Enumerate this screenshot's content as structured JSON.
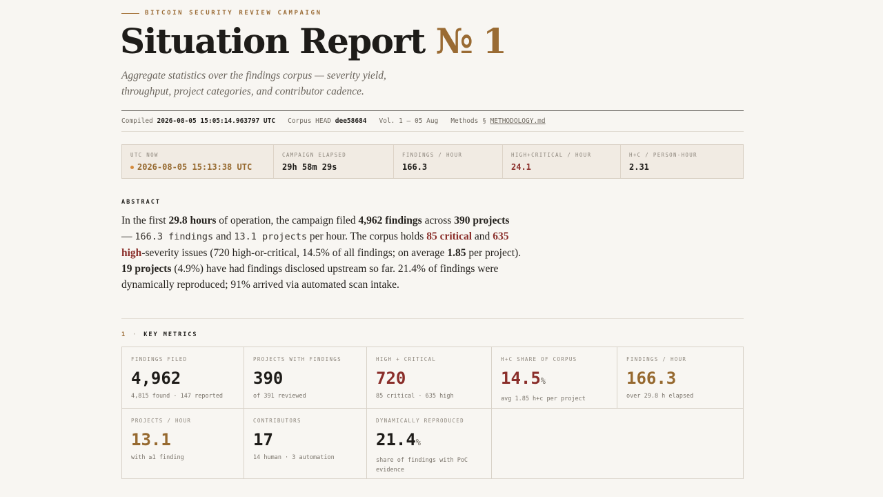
{
  "header": {
    "eyebrow": "BITCOIN SECURITY REVIEW CAMPAIGN",
    "title": "Situation Report",
    "title_number": "№ 1",
    "subtitle": "Aggregate statistics over the findings corpus — severity yield, throughput, project categories, and contributor cadence."
  },
  "meta": {
    "compiled_label": "Compiled",
    "compiled_value": "2026-08-05 15:05:14.963797 UTC",
    "head_label": "Corpus HEAD",
    "head_value": "dee58684",
    "volume": "Vol. 1 — 05 Aug",
    "methods_label": "Methods §",
    "methods_link": "METHODOLOGY.md"
  },
  "clock": [
    {
      "label": "UTC NOW",
      "value": "2026-08-05 15:13:38 UTC"
    },
    {
      "label": "CAMPAIGN ELAPSED",
      "value": "29h 58m 29s"
    },
    {
      "label": "FINDINGS / HOUR",
      "value": "166.3"
    },
    {
      "label": "HIGH+CRITICAL / HOUR",
      "value": "24.1"
    },
    {
      "label": "H+C / PERSON-HOUR",
      "value": "2.31"
    }
  ],
  "abstract": {
    "heading": "ABSTRACT",
    "t1": "In the first ",
    "b1": "29.8 hours",
    "t2": " of operation, the campaign filed ",
    "b2": "4,962 findings",
    "t3": " across ",
    "b3": "390 projects",
    "t4": " — ",
    "c1": "166.3 findings",
    "t5": " and ",
    "c2": "13.1 projects",
    "t6": " per hour. The corpus holds ",
    "r1": "85 critical",
    "t7": " and ",
    "r2": "635 high",
    "t8": "-severity issues (720 high-or-critical, 14.5% of all findings; on average ",
    "b4": "1.85",
    "t9": " per project). ",
    "b5": "19 projects",
    "t10": " (4.9%) have had findings disclosed upstream so far. 21.4% of findings were dynamically reproduced; 91% arrived via automated scan intake."
  },
  "section": {
    "number": "1",
    "sep": "·",
    "title": "KEY METRICS"
  },
  "metrics": [
    {
      "label": "FINDINGS FILED",
      "value": "4,962",
      "suffix": "",
      "sub": "4,815 found · 147 reported"
    },
    {
      "label": "PROJECTS WITH FINDINGS",
      "value": "390",
      "suffix": "",
      "sub": "of 391 reviewed"
    },
    {
      "label": "HIGH + CRITICAL",
      "value": "720",
      "suffix": "",
      "sub": "85 critical · 635 high"
    },
    {
      "label": "H+C SHARE OF CORPUS",
      "value": "14.5",
      "suffix": "%",
      "sub": "avg 1.85 h+c per project"
    },
    {
      "label": "FINDINGS / HOUR",
      "value": "166.3",
      "suffix": "",
      "sub": "over 29.8 h elapsed"
    },
    {
      "label": "PROJECTS / HOUR",
      "value": "13.1",
      "suffix": "",
      "sub": "with ≥1 finding"
    },
    {
      "label": "CONTRIBUTORS",
      "value": "17",
      "suffix": "",
      "sub": "14 human · 3 automation"
    },
    {
      "label": "DYNAMICALLY REPRODUCED",
      "value": "21.4",
      "suffix": "%",
      "sub": "share of findings with PoC evidence"
    }
  ],
  "colors": {
    "accent_gold": "#96692f",
    "accent_red": "#8a2e2a",
    "live_dot": "#d48a3c"
  }
}
